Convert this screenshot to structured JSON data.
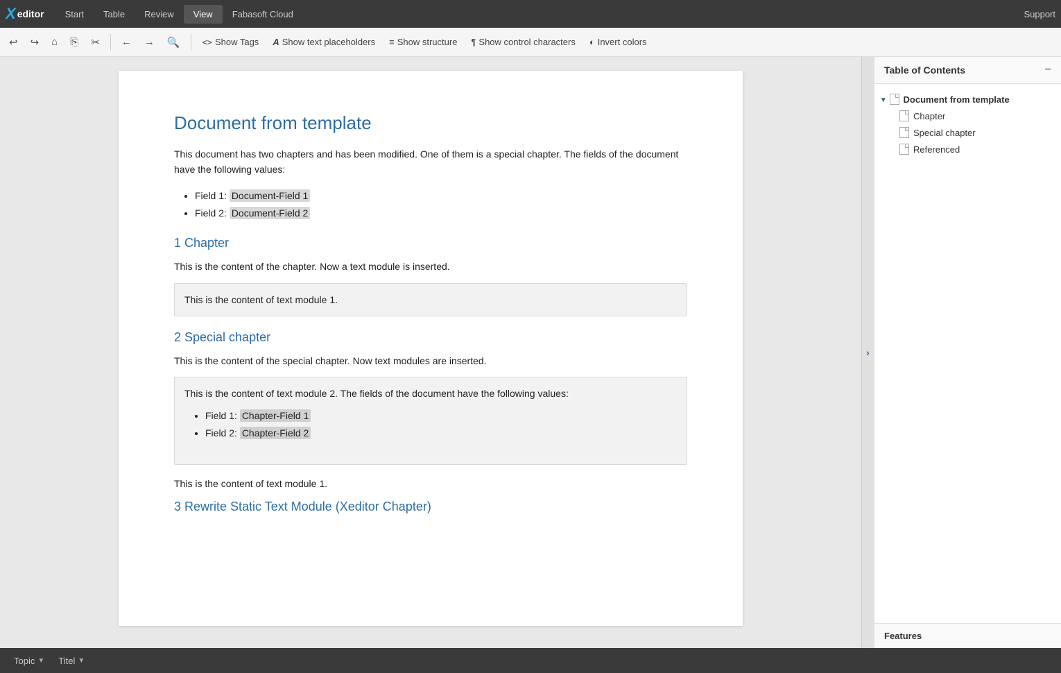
{
  "app": {
    "logo_x": "X",
    "logo_editor": "editor"
  },
  "menubar": {
    "items": [
      {
        "label": "Start",
        "active": false
      },
      {
        "label": "Table",
        "active": false
      },
      {
        "label": "Review",
        "active": false
      },
      {
        "label": "View",
        "active": true
      },
      {
        "label": "Fabasoft Cloud",
        "active": false
      }
    ],
    "support_label": "Support"
  },
  "toolbar": {
    "buttons": [
      {
        "id": "show-tags",
        "label": "Show Tags",
        "icon": "<>"
      },
      {
        "id": "show-text-placeholders",
        "label": "Show text placeholders",
        "icon": "A"
      },
      {
        "id": "show-structure",
        "label": "Show structure",
        "icon": "≡"
      },
      {
        "id": "show-control-characters",
        "label": "Show control characters",
        "icon": "¶"
      },
      {
        "id": "invert-colors",
        "label": "Invert colors",
        "icon": "◐"
      }
    ]
  },
  "document": {
    "title": "Document from template",
    "intro": "This document has two chapters and has been modified. One of them is a special chapter. The fields of the document have the following values:",
    "fields": [
      {
        "label": "Field 1:",
        "value": "Document-Field 1"
      },
      {
        "label": "Field 2:",
        "value": "Document-Field 2"
      }
    ],
    "chapter1": {
      "title": "1 Chapter",
      "content": "This is the content of the chapter. Now a text module is inserted.",
      "text_module": "This is the content of text module 1."
    },
    "chapter2": {
      "title": "2 Special chapter",
      "content": "This is the content of the special chapter. Now text modules are inserted.",
      "text_module_intro": "This is the content of text module 2. The fields of the document have the following values:",
      "fields": [
        {
          "label": "Field 1:",
          "value": "Chapter-Field 1"
        },
        {
          "label": "Field 2:",
          "value": "Chapter-Field 2"
        }
      ],
      "text_module2": "This is the content of text module 1."
    },
    "chapter3": {
      "title": "3 Rewrite Static Text Module (Xeditor Chapter)"
    }
  },
  "toc": {
    "title": "Table of Contents",
    "items": [
      {
        "level": 0,
        "label": "Document from template",
        "has_chevron": true
      },
      {
        "level": 1,
        "label": "Chapter"
      },
      {
        "level": 1,
        "label": "Special chapter"
      },
      {
        "level": 1,
        "label": "Referenced"
      }
    ],
    "features_label": "Features"
  },
  "statusbar": {
    "items": [
      {
        "label": "Topic"
      },
      {
        "label": "Titel"
      }
    ]
  }
}
